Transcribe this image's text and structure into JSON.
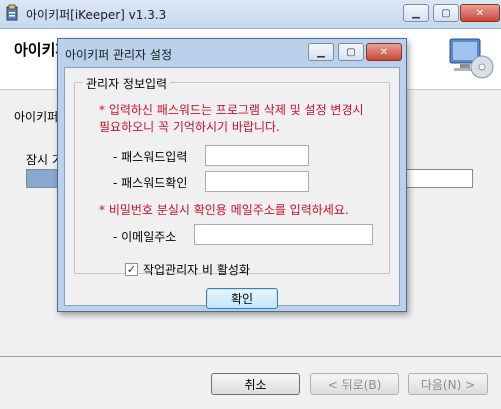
{
  "window": {
    "title": "아이키퍼[iKeeper] v1.3.3",
    "header_title": "아이키퍼 설치 중",
    "body_text": "아이키퍼를 설치하고 있습니다.",
    "wait_label": "잠시 기다려 주십시오...",
    "progress_fraction": 0.08,
    "buttons": {
      "cancel": "취소",
      "back": "< 뒤로(B)",
      "next": "다음(N) >"
    }
  },
  "dialog": {
    "title": "아이키퍼 관리자 설정",
    "group_legend": "관리자 정보입력",
    "warning_password": "* 입력하신 패스워드는 프로그램 삭제 및 설정 변경시\n필요하오니 꼭 기억하시기 바랍니다.",
    "password_label": "- 패스워드입력",
    "password_confirm_label": "- 패스워드확인",
    "warning_email": "* 비밀번호 분실시 확인용 메일주소를 입력하세요.",
    "email_label": "- 이메일주소",
    "checkbox_label": "작업관리자 비 활성화",
    "checkbox_checked": true,
    "ok_button": "확인"
  },
  "colors": {
    "warning_text": "#c8102e",
    "progress_fill": "#8aa7cf",
    "dialog_frame": "#b9d1ea"
  },
  "icons": {
    "app": "installer-icon",
    "header": "computer-disc-icon",
    "minimize": "minimize-icon",
    "maximize": "maximize-icon",
    "close": "close-icon",
    "check": "checkmark-icon"
  }
}
